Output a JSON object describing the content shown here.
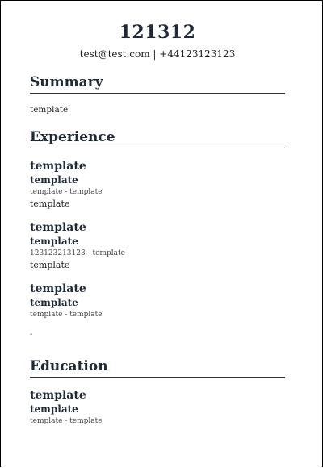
{
  "header": {
    "name": "121312",
    "contact": "test@test.com | +44123123123"
  },
  "summary": {
    "title": "Summary",
    "text": "template"
  },
  "experience": {
    "title": "Experience",
    "items": [
      {
        "title": "template",
        "subtitle": "template",
        "dates": "template - template",
        "description": "template"
      },
      {
        "title": "template",
        "subtitle": "template",
        "dates": "123123213123 - template",
        "description": "template"
      },
      {
        "title": "template",
        "subtitle": "template",
        "dates": "template - template",
        "description": ""
      }
    ],
    "trailing_mark": "-"
  },
  "education": {
    "title": "Education",
    "items": [
      {
        "title": "template",
        "subtitle": "template",
        "dates": "template - template"
      }
    ]
  }
}
